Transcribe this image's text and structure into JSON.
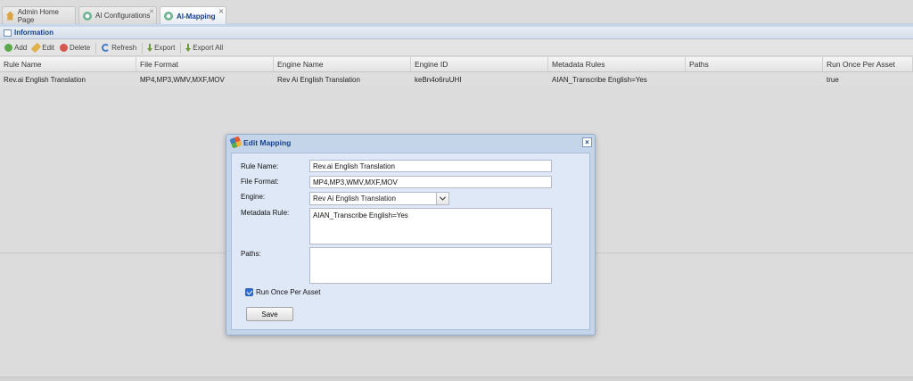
{
  "tabs": [
    {
      "label": "Admin Home Page",
      "icon": "home-icon"
    },
    {
      "label": "AI Configurations",
      "icon": "gear-icon"
    },
    {
      "label": "AI-Mapping",
      "icon": "gear-icon",
      "active": true
    }
  ],
  "panel": {
    "title": "Information"
  },
  "toolbar": {
    "add_label": "Add",
    "edit_label": "Edit",
    "delete_label": "Delete",
    "refresh_label": "Refresh",
    "export_label": "Export",
    "export_all_label": "Export All"
  },
  "grid": {
    "columns": [
      "Rule Name",
      "File Format",
      "Engine Name",
      "Engine ID",
      "Metadata Rules",
      "Paths",
      "Run Once Per Asset"
    ],
    "rows": [
      [
        "Rev.ai English Translation",
        "MP4,MP3,WMV,MXF,MOV",
        "Rev Ai English Translation",
        "keBn4o6ruUHI",
        "AIAN_Transcribe English=Yes",
        "",
        "true"
      ]
    ]
  },
  "dialog": {
    "title": "Edit Mapping",
    "close_label": "×",
    "rule_name_label": "Rule Name:",
    "rule_name_value": "Rev.ai English Translation",
    "file_format_label": "File Format:",
    "file_format_value": "MP4,MP3,WMV,MXF,MOV",
    "engine_label": "Engine:",
    "engine_value": "Rev Ai English Translation",
    "metadata_rule_label": "Metadata Rule:",
    "metadata_rule_value": "AIAN_Transcribe English=Yes",
    "paths_label": "Paths:",
    "paths_value": "",
    "run_once_label": "Run Once Per Asset",
    "run_once_checked": true,
    "save_label": "Save"
  }
}
